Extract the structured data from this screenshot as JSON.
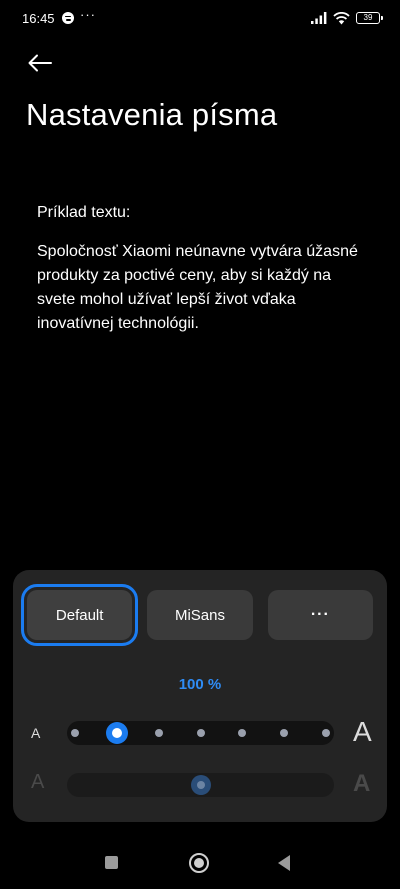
{
  "status_bar": {
    "time": "16:45",
    "more": "···",
    "battery": "39",
    "icons": [
      "spotify-icon",
      "signal-icon",
      "wifi-icon",
      "battery-icon"
    ]
  },
  "header": {
    "back_icon": "arrow-left-icon",
    "title": "Nastavenia písma"
  },
  "sample": {
    "label": "Príklad textu:",
    "text": "Spoločnosť Xiaomi neúnavne vytvára úžasné produkty za poctivé ceny, aby si každý na svete mohol užívať lepší život vďaka inovatívnej technológii."
  },
  "fonts": {
    "selected": "Default",
    "options": [
      {
        "label": "Default"
      },
      {
        "label": "MiSans"
      },
      {
        "label": "···"
      }
    ]
  },
  "size": {
    "percent_label": "100 %",
    "small_label": "A",
    "large_label": "A",
    "steps": 7,
    "selected_step": 1
  },
  "weight": {
    "small_label": "A",
    "large_label": "A",
    "level": 0.5
  },
  "colors": {
    "accent": "#1b7cf0",
    "panel": "#242424",
    "background": "#000000"
  },
  "nav": {
    "icons": [
      "recents-icon",
      "home-icon",
      "back-icon"
    ]
  }
}
